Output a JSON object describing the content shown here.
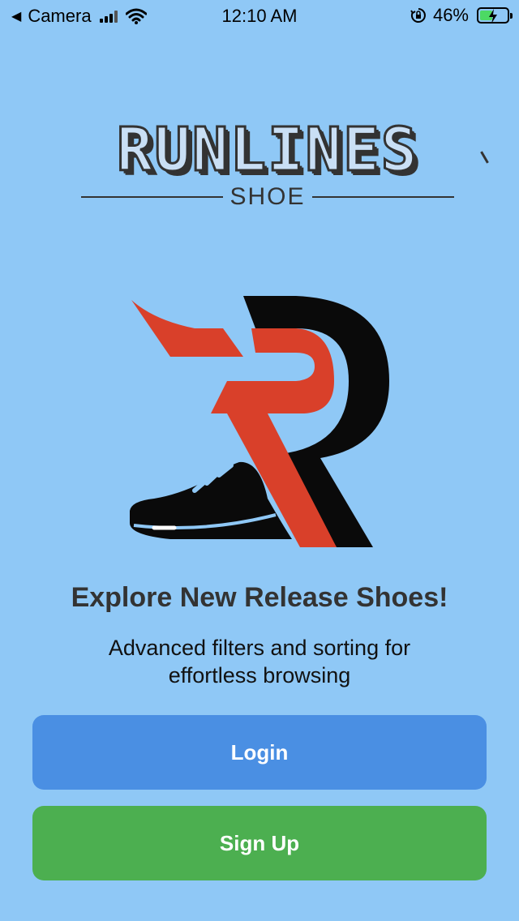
{
  "status_bar": {
    "back_glyph": "◀",
    "carrier": "Camera",
    "time": "12:10 AM",
    "battery_percent": "46%",
    "battery_level": 0.46,
    "battery_color": "#4cd964",
    "icons": [
      "signal-icon",
      "wifi-icon",
      "orientation-lock-icon",
      "battery-icon"
    ]
  },
  "brand": {
    "title": "RUNLINES",
    "subtitle": "SHOE"
  },
  "colors": {
    "background": "#8fc8f6",
    "logo_red": "#d9402a",
    "logo_black": "#0a0a0a",
    "login": "#4a8fe3",
    "signup": "#4caf50"
  },
  "main": {
    "headline": "Explore New Release Shoes!",
    "subtext": "Advanced filters and sorting for effortless browsing"
  },
  "actions": {
    "login_label": "Login",
    "signup_label": "Sign Up"
  }
}
